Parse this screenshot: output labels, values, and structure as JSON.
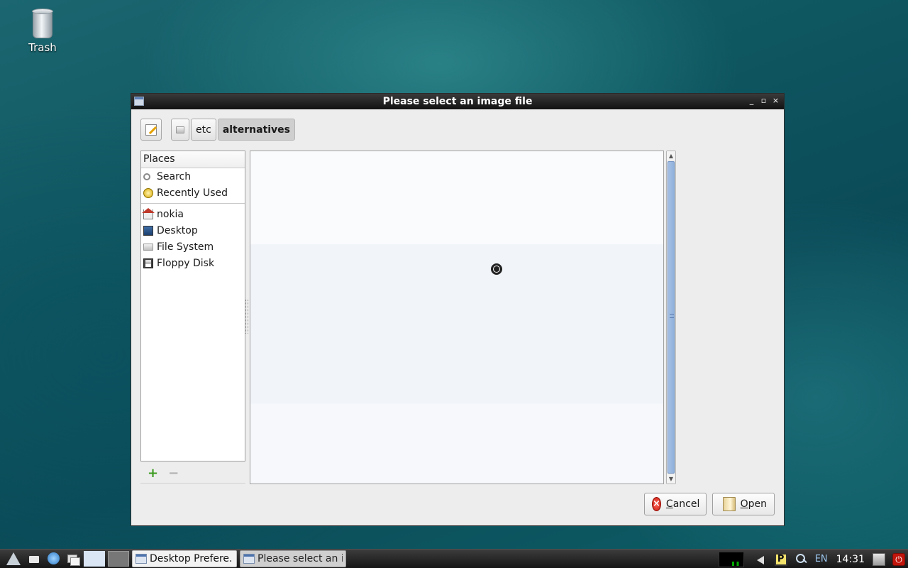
{
  "desktop": {
    "icons": [
      {
        "label": "Trash",
        "icon": "trash-icon"
      }
    ]
  },
  "dialog": {
    "title": "Please select an image file",
    "controls": [
      "minimize",
      "maximize",
      "close"
    ],
    "pathbar": {
      "edit_icon": "pencil-icon",
      "crumbs": [
        {
          "label": "",
          "icon": "filesystem-icon"
        },
        {
          "label": "etc"
        },
        {
          "label": "alternatives",
          "active": true
        }
      ]
    },
    "places": {
      "header": "Places",
      "items": [
        {
          "label": "Search",
          "icon": "search-icon"
        },
        {
          "label": "Recently Used",
          "icon": "clock-icon"
        },
        {
          "label": "nokia",
          "icon": "home-icon"
        },
        {
          "label": "Desktop",
          "icon": "desktop-icon"
        },
        {
          "label": "File System",
          "icon": "disk-icon"
        },
        {
          "label": "Floppy Disk",
          "icon": "floppy-icon"
        }
      ],
      "add": "+",
      "remove": "−"
    },
    "buttons": {
      "cancel": {
        "label": "Cancel",
        "mnemonic": "C",
        "rest": "ancel"
      },
      "open": {
        "label": "Open",
        "mnemonic": "O",
        "rest": "pen"
      }
    }
  },
  "taskbar": {
    "tasks": [
      {
        "label": "Desktop Prefere..."
      },
      {
        "label": "Please select an i..."
      }
    ],
    "tray": {
      "keyboard_layout": "EN",
      "clock": "14:31",
      "p_label": "P"
    }
  }
}
